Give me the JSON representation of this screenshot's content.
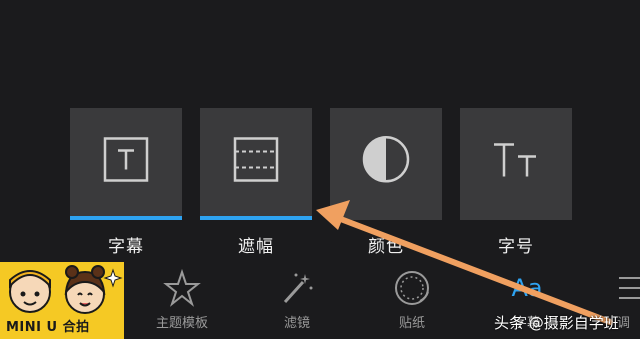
{
  "tiles": [
    {
      "label": "字幕",
      "icon": "text-box-icon",
      "selected": true
    },
    {
      "label": "遮幅",
      "icon": "letterbox-icon",
      "selected": true
    },
    {
      "label": "颜色",
      "icon": "contrast-icon",
      "selected": false
    },
    {
      "label": "字号",
      "icon": "font-size-icon",
      "selected": false
    }
  ],
  "toolbar": {
    "items": [
      {
        "label": "主题模板",
        "icon": "star-icon"
      },
      {
        "label": "滤镜",
        "icon": "magic-wand-icon"
      },
      {
        "label": "贴纸",
        "icon": "sticker-icon"
      },
      {
        "label": "字幕",
        "icon": "text-aa-icon",
        "glyph": "Aa"
      },
      {
        "label": "调",
        "icon": "adjust-icon"
      }
    ]
  },
  "sticker": {
    "text": "MINI U 合拍"
  },
  "watermark": "头条 @摄影自学班",
  "colors": {
    "accent": "#2ea3f2",
    "tile": "#3a3a3c",
    "background": "#1b1b1d",
    "arrow": "#f0a060"
  }
}
